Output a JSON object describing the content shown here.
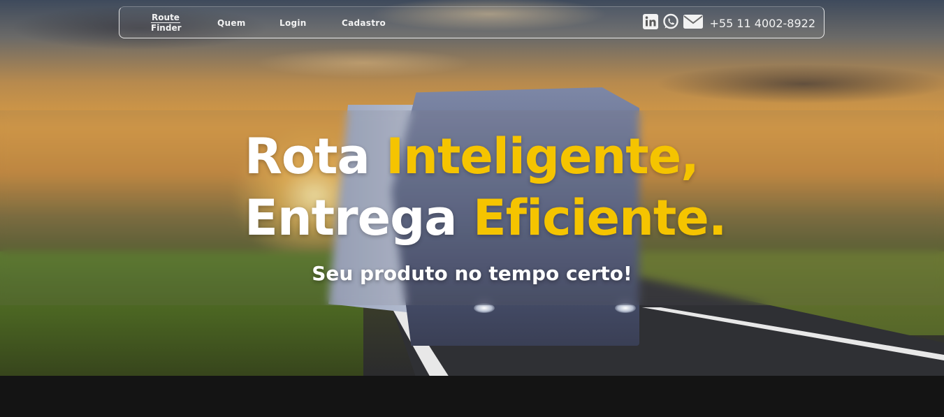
{
  "nav": {
    "brand_line1": "Route",
    "brand_line2": "Finder",
    "links": [
      "Quem",
      "Login",
      "Cadastro"
    ],
    "social_icons": [
      "linkedin-icon",
      "whatsapp-icon",
      "envelope-icon"
    ],
    "phone": "+55 11 4002-8922"
  },
  "hero": {
    "headline_word1": "Rota",
    "headline_word2": "Inteligente,",
    "headline_word3": "Entrega",
    "headline_word4": "Eficiente.",
    "subtitle": "Seu produto no tempo certo!",
    "accent_color": "#f5c400",
    "text_color": "#ffffff"
  },
  "colors": {
    "footer_bg": "#141414"
  }
}
